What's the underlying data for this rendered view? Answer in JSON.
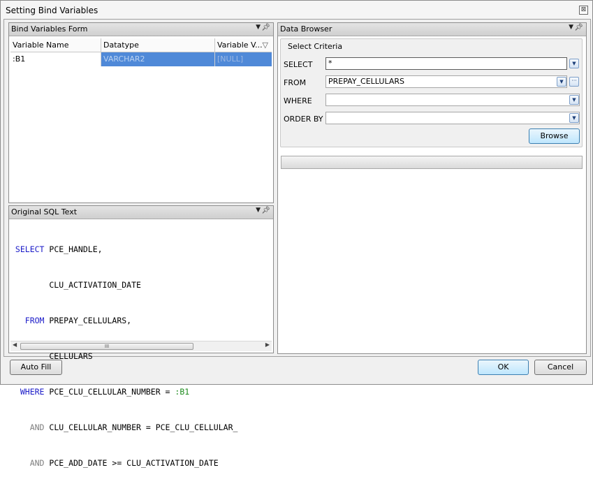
{
  "window": {
    "title": "Setting Bind Variables",
    "close_glyph": "⊠"
  },
  "bind_form": {
    "title": "Bind Variables Form",
    "columns": [
      "Variable Name",
      "Datatype",
      "Variable V..."
    ],
    "filter_glyph": "▽",
    "rows": [
      {
        "name": ":B1",
        "datatype": "VARCHAR2",
        "value": "[NULL]"
      }
    ]
  },
  "sql_panel": {
    "title": "Original SQL Text",
    "lines": [
      {
        "kw": " SELECT",
        "rest": " PCE_HANDLE,"
      },
      {
        "kw": "",
        "rest": "        CLU_ACTIVATION_DATE"
      },
      {
        "kw": "   FROM",
        "rest": " PREPAY_CELLULARS,"
      },
      {
        "kw": "",
        "rest": "        CELLULARS"
      },
      {
        "kw": "  WHERE",
        "rest": " PCE_CLU_CELLULAR_NUMBER = ",
        "bind": ":B1"
      },
      {
        "kw2": "    AND",
        "rest": " CLU_CELLULAR_NUMBER = PCE_CLU_CELLULAR_"
      },
      {
        "kw2": "    AND",
        "rest": " PCE_ADD_DATE >= CLU_ACTIVATION_DATE"
      }
    ],
    "scroll_grip": "III"
  },
  "data_browser": {
    "title": "Data Browser",
    "group_title": "Select Criteria",
    "select_label": "SELECT",
    "select_value": "*",
    "from_label": "FROM",
    "from_value": "PREPAY_CELLULARS",
    "where_label": "WHERE",
    "where_value": "",
    "orderby_label": "ORDER BY",
    "orderby_value": "",
    "browse_label": "Browse",
    "ellipsis": "···"
  },
  "footer": {
    "autofill_label": "Auto Fill",
    "ok_label": "OK",
    "cancel_label": "Cancel"
  },
  "icons": {
    "pin": "pin-icon",
    "dropdown": "chevron-down-icon",
    "close": "close-icon"
  }
}
